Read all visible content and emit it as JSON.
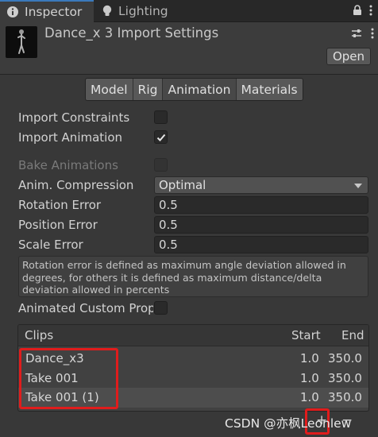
{
  "tabs": [
    {
      "label": "Inspector"
    },
    {
      "label": "Lighting"
    }
  ],
  "header": {
    "title": "Dance_x 3 Import Settings",
    "open_label": "Open"
  },
  "toolbar": {
    "items": [
      "Model",
      "Rig",
      "Animation",
      "Materials"
    ],
    "selected": "Animation"
  },
  "props": {
    "import_constraints": {
      "label": "Import Constraints",
      "checked": false
    },
    "import_animation": {
      "label": "Import Animation",
      "checked": true
    },
    "bake_animations": {
      "label": "Bake Animations",
      "checked": false,
      "disabled": true
    },
    "anim_compression": {
      "label": "Anim. Compression",
      "value": "Optimal"
    },
    "rotation_error": {
      "label": "Rotation Error",
      "value": "0.5"
    },
    "position_error": {
      "label": "Position Error",
      "value": "0.5"
    },
    "scale_error": {
      "label": "Scale Error",
      "value": "0.5"
    },
    "help_text": "Rotation error is defined as maximum angle deviation allowed in degrees, for others it is defined as maximum distance/delta deviation allowed in percents",
    "animated_custom": {
      "label": "Animated Custom Prope",
      "checked": false
    }
  },
  "clips": {
    "header": {
      "name": "Clips",
      "start": "Start",
      "end": "End"
    },
    "rows": [
      {
        "name": "Dance_x3",
        "start": "1.0",
        "end": "350.0"
      },
      {
        "name": "Take 001",
        "start": "1.0",
        "end": "350.0"
      },
      {
        "name": "Take 001 (1)",
        "start": "1.0",
        "end": "350.0"
      }
    ]
  },
  "list_buttons": {
    "add": "+",
    "remove": "−"
  },
  "watermark": "CSDN @亦枫Leonlew",
  "colors": {
    "accent": "#3a79bb",
    "highlight": "#e01c1c"
  }
}
